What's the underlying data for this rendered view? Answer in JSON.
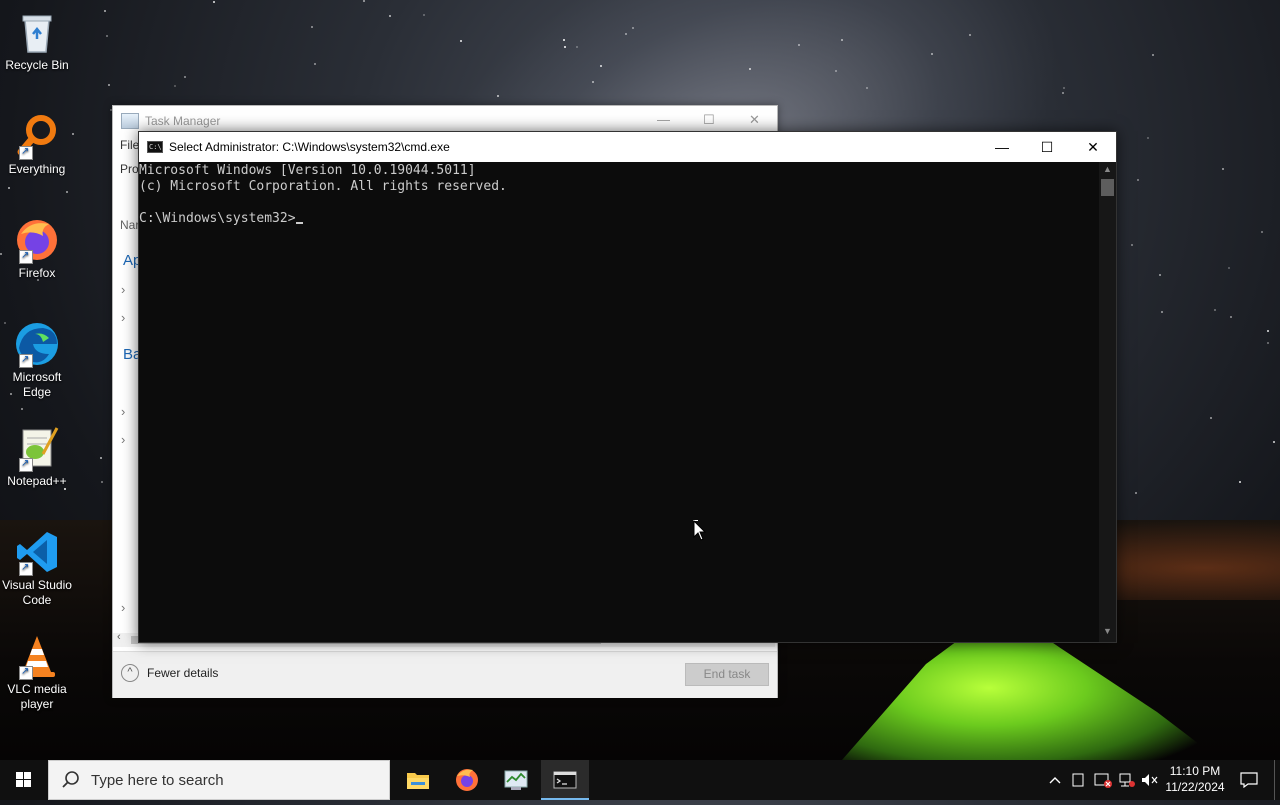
{
  "desktop": {
    "icons": [
      {
        "label": "Recycle Bin",
        "icon": "recycle-bin-icon"
      },
      {
        "label": "Everything",
        "icon": "everything-search-icon"
      },
      {
        "label": "Firefox",
        "icon": "firefox-icon"
      },
      {
        "label": "Microsoft Edge",
        "icon": "edge-icon"
      },
      {
        "label": "Notepad++",
        "icon": "notepadpp-icon"
      },
      {
        "label": "Visual Studio Code",
        "icon": "vscode-icon"
      },
      {
        "label": "VLC media player",
        "icon": "vlc-icon"
      }
    ]
  },
  "task_manager": {
    "title": "Task Manager",
    "menu_fragment": "File",
    "tab_fragment": "Pro",
    "column_fragment": "Nar",
    "section_apps_fragment": "Ap",
    "section_bg_fragment": "Ba",
    "fewer_details_label": "Fewer details",
    "end_task_label": "End task"
  },
  "cmd": {
    "title": "Select Administrator: C:\\Windows\\system32\\cmd.exe",
    "lines": [
      "Microsoft Windows [Version 10.0.19044.5011]",
      "(c) Microsoft Corporation. All rights reserved.",
      "",
      "C:\\Windows\\system32>"
    ],
    "minimize_label": "—",
    "maximize_label": "☐",
    "close_label": "✕"
  },
  "taskbar": {
    "search_placeholder": "Type here to search",
    "apps": [
      {
        "name": "file-explorer",
        "icon": "folder-icon",
        "active": false
      },
      {
        "name": "firefox",
        "icon": "firefox-icon",
        "active": false
      },
      {
        "name": "task-manager",
        "icon": "task-manager-icon",
        "active": false
      },
      {
        "name": "cmd",
        "icon": "cmd-icon",
        "active": true
      }
    ],
    "clock_time": "11:10 PM",
    "clock_date": "11/22/2024"
  },
  "colors": {
    "cmd_background": "#0c0c0c",
    "cmd_text": "#cccccc",
    "taskbar": "#101010",
    "accent": "#76b9ed"
  }
}
